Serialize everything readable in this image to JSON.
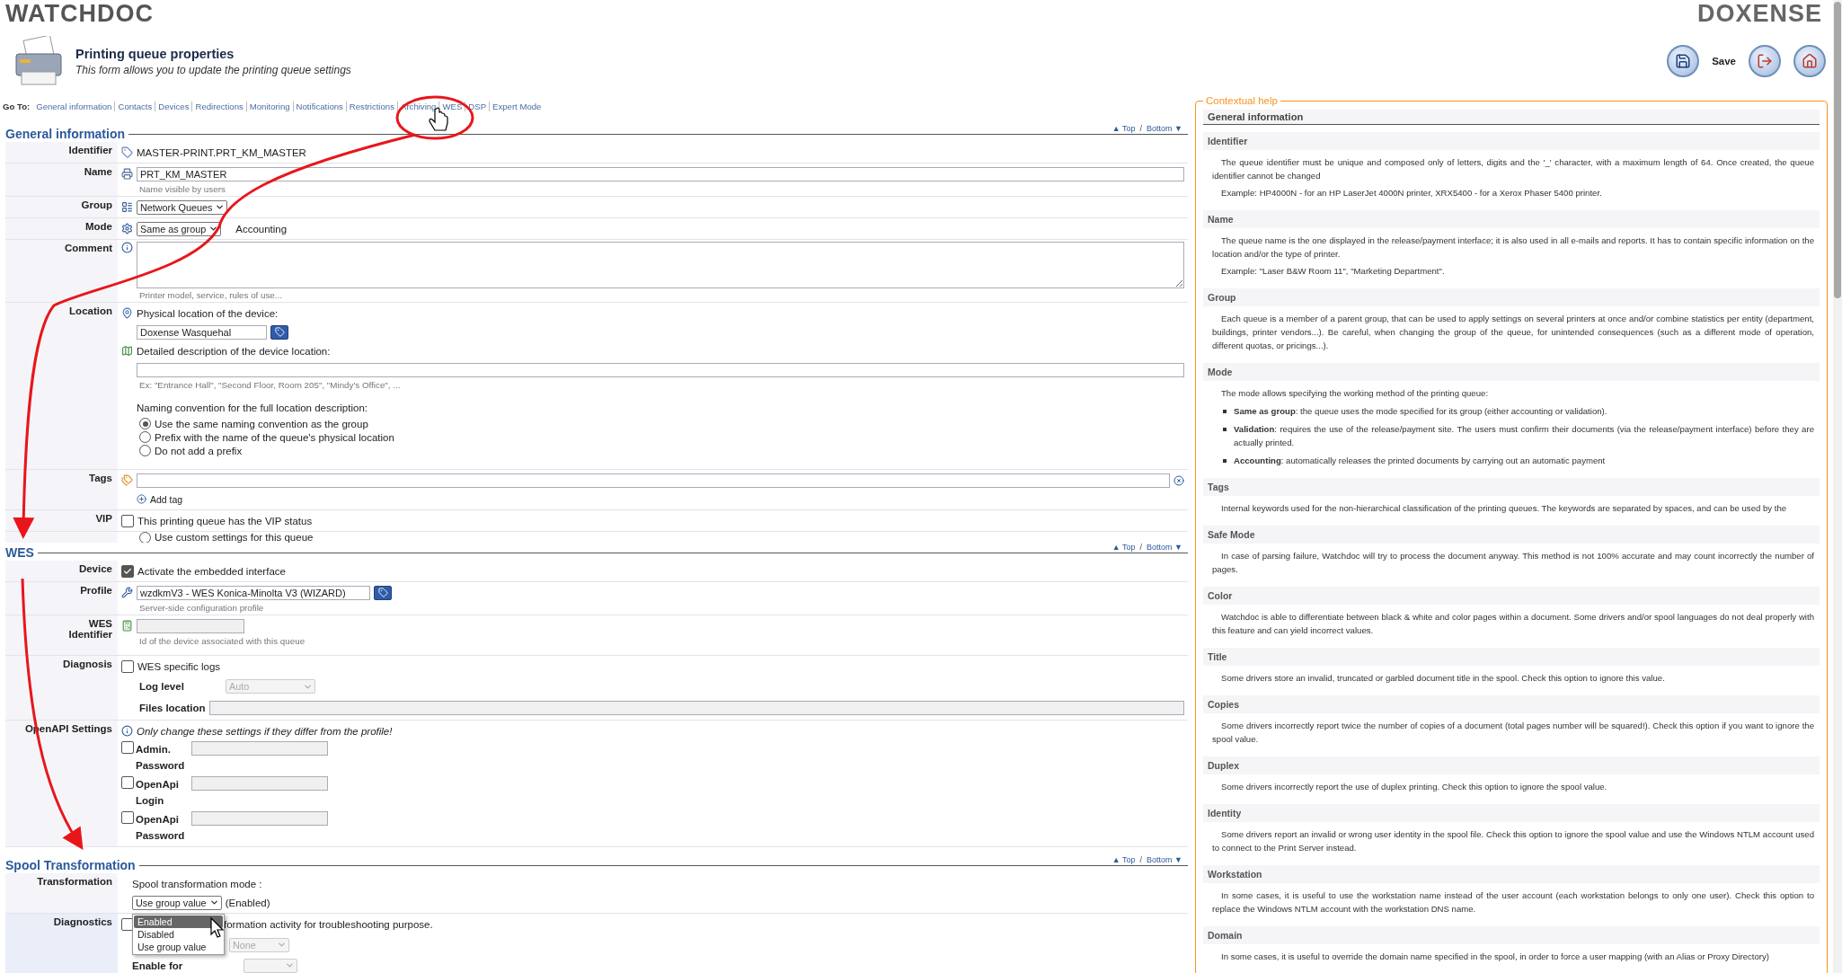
{
  "header": {
    "logo": "WATCHDOC",
    "brand": "DOXENSE"
  },
  "page": {
    "title": "Printing queue properties",
    "subtitle": "This form allows you to update the printing queue settings"
  },
  "toolbar": [
    {
      "kind": "save",
      "label": "Save"
    },
    {
      "kind": "exit"
    },
    {
      "kind": "home"
    }
  ],
  "goto": {
    "label": "Go To:",
    "links": [
      "General information",
      "Contacts",
      "Devices",
      "Redirections",
      "Monitoring",
      "Notifications",
      "Restrictions",
      "Archiving",
      "WES",
      "DSP",
      "Expert Mode"
    ]
  },
  "general_information": {
    "title": "General information",
    "nav": {
      "top": "▲ Top",
      "separator": "/",
      "bottom": "Bottom ▼"
    },
    "identifier": {
      "label": "Identifier",
      "value": "MASTER-PRINT.PRT_KM_MASTER"
    },
    "name": {
      "label": "Name",
      "value": "PRT_KM_MASTER",
      "hint": "Name visible by users"
    },
    "group": {
      "label": "Group",
      "value": "Network Queues"
    },
    "mode": {
      "label": "Mode",
      "value": "Same as group",
      "note": "Accounting"
    },
    "comment": {
      "label": "Comment",
      "hint": "Printer model, service, rules of use..."
    },
    "location": {
      "label": "Location",
      "physical_label": "Physical location of the device:",
      "physical_value": "Doxense Wasquehal",
      "detail_label": "Detailed description of the device location:",
      "detail_hint": "Ex: \"Entrance Hall\", \"Second Floor, Room 205\", \"Mindy's Office\", ...",
      "naming_label": "Naming convention for the full location description:",
      "naming_options": [
        {
          "label": "Use the same naming convention as the group",
          "selected": true
        },
        {
          "label": "Prefix with the name of the queue's physical location",
          "selected": false
        },
        {
          "label": "Do not add a prefix",
          "selected": false
        }
      ]
    },
    "tags": {
      "label": "Tags",
      "add": "Add tag"
    },
    "vip": {
      "label": "VIP",
      "text": "This printing queue has the VIP status",
      "checked": false
    },
    "cut_option": {
      "label": "Use custom settings for this queue",
      "selected": false
    }
  },
  "wes": {
    "title": "WES",
    "nav": {
      "top": "▲ Top",
      "separator": "/",
      "bottom": "Bottom ▼"
    },
    "device": {
      "label": "Device",
      "text": "Activate the embedded interface",
      "checked": true
    },
    "profile": {
      "label": "Profile",
      "value": "wzdkmV3 - WES Konica-Minolta V3 (WIZARD)",
      "hint": "Server-side configuration profile"
    },
    "identifier": {
      "label": "WES Identifier",
      "hint": "Id of the device associated with this queue"
    },
    "diagnosis": {
      "label": "Diagnosis",
      "text": "WES specific logs",
      "checked": false,
      "log_level_label": "Log level",
      "log_level_value": "Auto",
      "files_label": "Files location"
    },
    "openapi": {
      "label": "OpenAPI Settings",
      "note": "Only change these settings if they differ from the profile!",
      "fields": [
        {
          "label": "Admin. Password",
          "checked": false
        },
        {
          "label": "OpenApi Login",
          "checked": false
        },
        {
          "label": "OpenApi Password",
          "checked": false
        }
      ]
    }
  },
  "spool_transformation": {
    "title": "Spool Transformation",
    "nav": {
      "top": "▲ Top",
      "separator": "/",
      "bottom": "Bottom ▼"
    },
    "transformation": {
      "label": "Transformation",
      "mode_label": "Spool transformation mode :",
      "value": "Use group value",
      "note": "(Enabled)"
    },
    "dropdown": {
      "options": [
        {
          "label": "Enabled",
          "selected": true
        },
        {
          "label": "Disabled",
          "selected": false
        },
        {
          "label": "Use group value",
          "selected": false
        }
      ]
    },
    "diagnostics": {
      "label": "Diagnostics",
      "checked": false,
      "text": "formation activity for troubleshooting purpose.",
      "level_value": "None",
      "enable_for_label": "Enable for"
    }
  },
  "help": {
    "title": "Contextual help",
    "heading": "General information",
    "sections": [
      {
        "title": "Identifier",
        "paragraphs": [
          "The queue identifier must be unique and composed only of letters, digits and the '_' character, with a maximum length of 64. Once created, the queue identifier cannot be changed",
          "Example: HP4000N - for an HP LaserJet 4000N printer, XRX5400 - for a Xerox Phaser 5400 printer."
        ]
      },
      {
        "title": "Name",
        "paragraphs": [
          "The queue name is the one displayed in the release/payment interface; it is also used in all e-mails and reports. It has to contain specific information on the location and/or the type of printer.",
          "Example: \"Laser B&W Room 11\", \"Marketing Department\"."
        ]
      },
      {
        "title": "Group",
        "paragraphs": [
          "Each queue is a member of a parent group, that can be used to apply settings on several printers at once and/or combine statistics per entity (department, buildings, printer vendors...). Be careful, when changing the group of the queue, for unintended consequences (such as a different mode of operation, different quotas, or pricings...)."
        ]
      },
      {
        "title": "Mode",
        "paragraphs": [
          "The mode allows specifying the working method of the printing queue:"
        ],
        "bullets": [
          "**Same as group**: the queue uses the mode specified for its group (either accounting or validation).",
          "**Validation**: requires the use of the release/payment site. The users must confirm their documents (via the release/payment interface) before they are actually printed.",
          "**Accounting**: automatically releases the printed documents by carrying out an automatic payment"
        ]
      },
      {
        "title": "Tags",
        "paragraphs": [
          "Internal keywords used for the non-hierarchical classification of the printing queues. The keywords are separated by spaces, and can be used by the"
        ]
      },
      {
        "title": "Safe Mode",
        "paragraphs": [
          "In case of parsing failure, Watchdoc will try to process the document anyway. This method is not 100% accurate and may count incorrectly the number of pages."
        ]
      },
      {
        "title": "Color",
        "paragraphs": [
          "Watchdoc is able to differentiate between black & white and color pages within a document. Some drivers and/or spool languages do not deal properly with this feature and can yield incorrect values."
        ]
      },
      {
        "title": "Title",
        "paragraphs": [
          "Some drivers store an invalid, truncated or garbled document title in the spool. Check this option to ignore this value."
        ]
      },
      {
        "title": "Copies",
        "paragraphs": [
          "Some drivers incorrectly report twice the number of copies of a document (total pages number will be squared!). Check this option if you want to ignore the spool value."
        ]
      },
      {
        "title": "Duplex",
        "paragraphs": [
          "Some drivers incorrectly report the use of duplex printing. Check this option to ignore the spool value."
        ]
      },
      {
        "title": "Identity",
        "paragraphs": [
          "Some drivers report an invalid or wrong user identity in the spool file. Check this option to ignore the spool value and use the Windows NTLM account used to connect to the Print Server instead."
        ]
      },
      {
        "title": "Workstation",
        "paragraphs": [
          "In some cases, it is useful to use the workstation name instead of the user account (each workstation belongs to only one user). Check this option to replace the Windows NTLM account with the workstation DNS name."
        ]
      },
      {
        "title": "Domain",
        "paragraphs": [
          "In some cases, it is useful to override the domain name specified in the spool, in order to force a user mapping (with an Alias or Proxy Directory)"
        ]
      }
    ]
  }
}
